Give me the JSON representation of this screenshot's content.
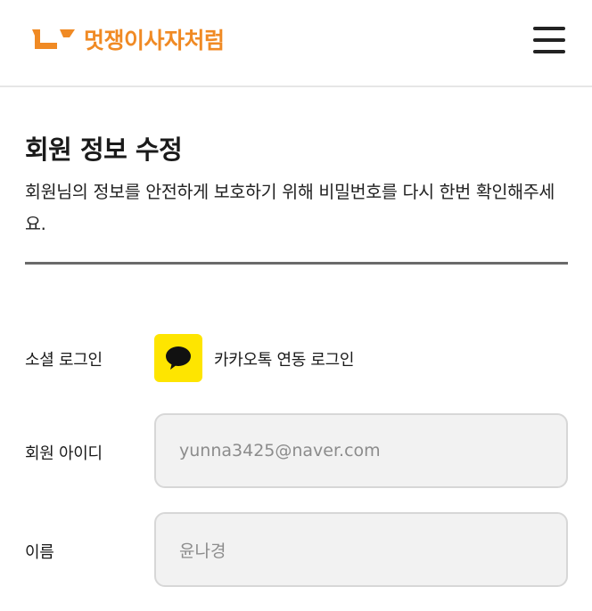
{
  "header": {
    "logo_text": "멋쟁이사자처럼",
    "brand_color": "#f08a24",
    "menu_icon": "hamburger-menu-icon"
  },
  "main": {
    "title": "회원 정보 수정",
    "description": "회원님의 정보를 안전하게 보호하기 위해 비밀번호를 다시 한번 확인해주세요."
  },
  "form": {
    "social_login": {
      "label": "소셜 로그인",
      "icon": "kakao-chat-icon",
      "icon_color": "#fee500",
      "text": "카카오톡 연동 로그인"
    },
    "member_id": {
      "label": "회원 아이디",
      "value": "yunna3425@naver.com"
    },
    "name": {
      "label": "이름",
      "value": "윤나경"
    }
  }
}
